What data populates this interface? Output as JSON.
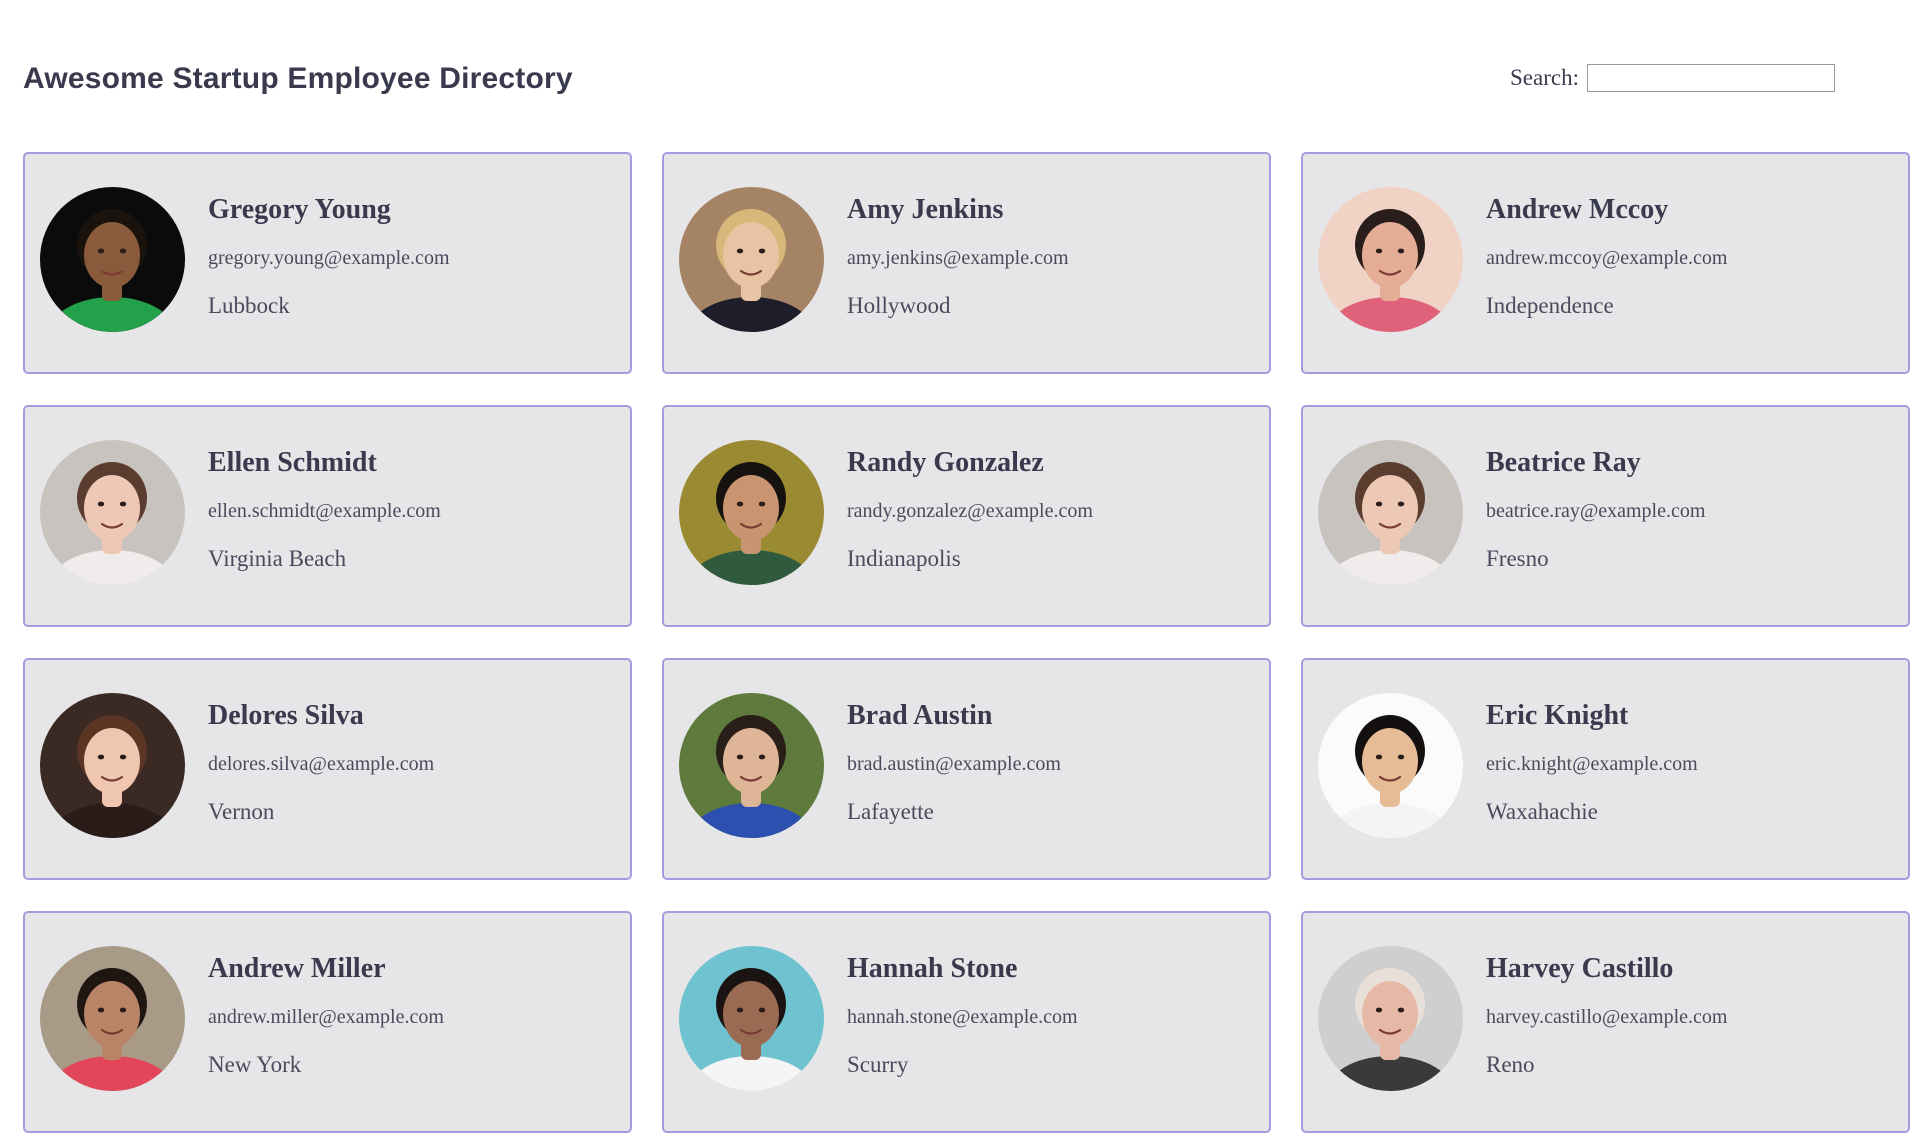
{
  "header": {
    "title": "Awesome Startup Employee Directory",
    "search_label": "Search:",
    "search_value": ""
  },
  "employees": [
    {
      "name": "Gregory Young",
      "email": "gregory.young@example.com",
      "city": "Lubbock",
      "avatar": {
        "bg": "#0b0b0b",
        "skin": "#8a5a3c",
        "hair": "#1a120c",
        "shirt": "#23a04a"
      }
    },
    {
      "name": "Amy Jenkins",
      "email": "amy.jenkins@example.com",
      "city": "Hollywood",
      "avatar": {
        "bg": "#a58466",
        "skin": "#e8c3a4",
        "hair": "#d9b67a",
        "shirt": "#1e1e2a"
      }
    },
    {
      "name": "Andrew Mccoy",
      "email": "andrew.mccoy@example.com",
      "city": "Independence",
      "avatar": {
        "bg": "#f1d3c6",
        "skin": "#e5ad95",
        "hair": "#2a1e1c",
        "shirt": "#e0627a"
      }
    },
    {
      "name": "Ellen Schmidt",
      "email": "ellen.schmidt@example.com",
      "city": "Virginia Beach",
      "avatar": {
        "bg": "#c9c3bf",
        "skin": "#ecc8b5",
        "hair": "#5a3d2e",
        "shirt": "#f0eceb"
      }
    },
    {
      "name": "Randy Gonzalez",
      "email": "randy.gonzalez@example.com",
      "city": "Indianapolis",
      "avatar": {
        "bg": "#9a8a32",
        "skin": "#c99470",
        "hair": "#161210",
        "shirt": "#2f5a3e"
      }
    },
    {
      "name": "Beatrice Ray",
      "email": "beatrice.ray@example.com",
      "city": "Fresno",
      "avatar": {
        "bg": "#c9c3bf",
        "skin": "#ecc8b5",
        "hair": "#5a3d2e",
        "shirt": "#f0eceb"
      }
    },
    {
      "name": "Delores Silva",
      "email": "delores.silva@example.com",
      "city": "Vernon",
      "avatar": {
        "bg": "#3b2a24",
        "skin": "#efc7b0",
        "hair": "#5a3524",
        "shirt": "#2a1c18"
      }
    },
    {
      "name": "Brad Austin",
      "email": "brad.austin@example.com",
      "city": "Lafayette",
      "avatar": {
        "bg": "#5e7a3c",
        "skin": "#dfb598",
        "hair": "#2a1e18",
        "shirt": "#2c4fb0"
      }
    },
    {
      "name": "Eric Knight",
      "email": "eric.knight@example.com",
      "city": "Waxahachie",
      "avatar": {
        "bg": "#fbfbfb",
        "skin": "#e6bc96",
        "hair": "#141010",
        "shirt": "#f4f4f4"
      }
    },
    {
      "name": "Andrew Miller",
      "email": "andrew.miller@example.com",
      "city": "New York",
      "avatar": {
        "bg": "#a89a86",
        "skin": "#b98366",
        "hair": "#1f1612",
        "shirt": "#e2465a"
      }
    },
    {
      "name": "Hannah Stone",
      "email": "hannah.stone@example.com",
      "city": "Scurry",
      "avatar": {
        "bg": "#6fc2cf",
        "skin": "#9b6a52",
        "hair": "#1c1412",
        "shirt": "#f5f5f5"
      }
    },
    {
      "name": "Harvey Castillo",
      "email": "harvey.castillo@example.com",
      "city": "Reno",
      "avatar": {
        "bg": "#cfcfcf",
        "skin": "#e6b9a6",
        "hair": "#e8e0d8",
        "shirt": "#3a3a3a"
      }
    }
  ]
}
